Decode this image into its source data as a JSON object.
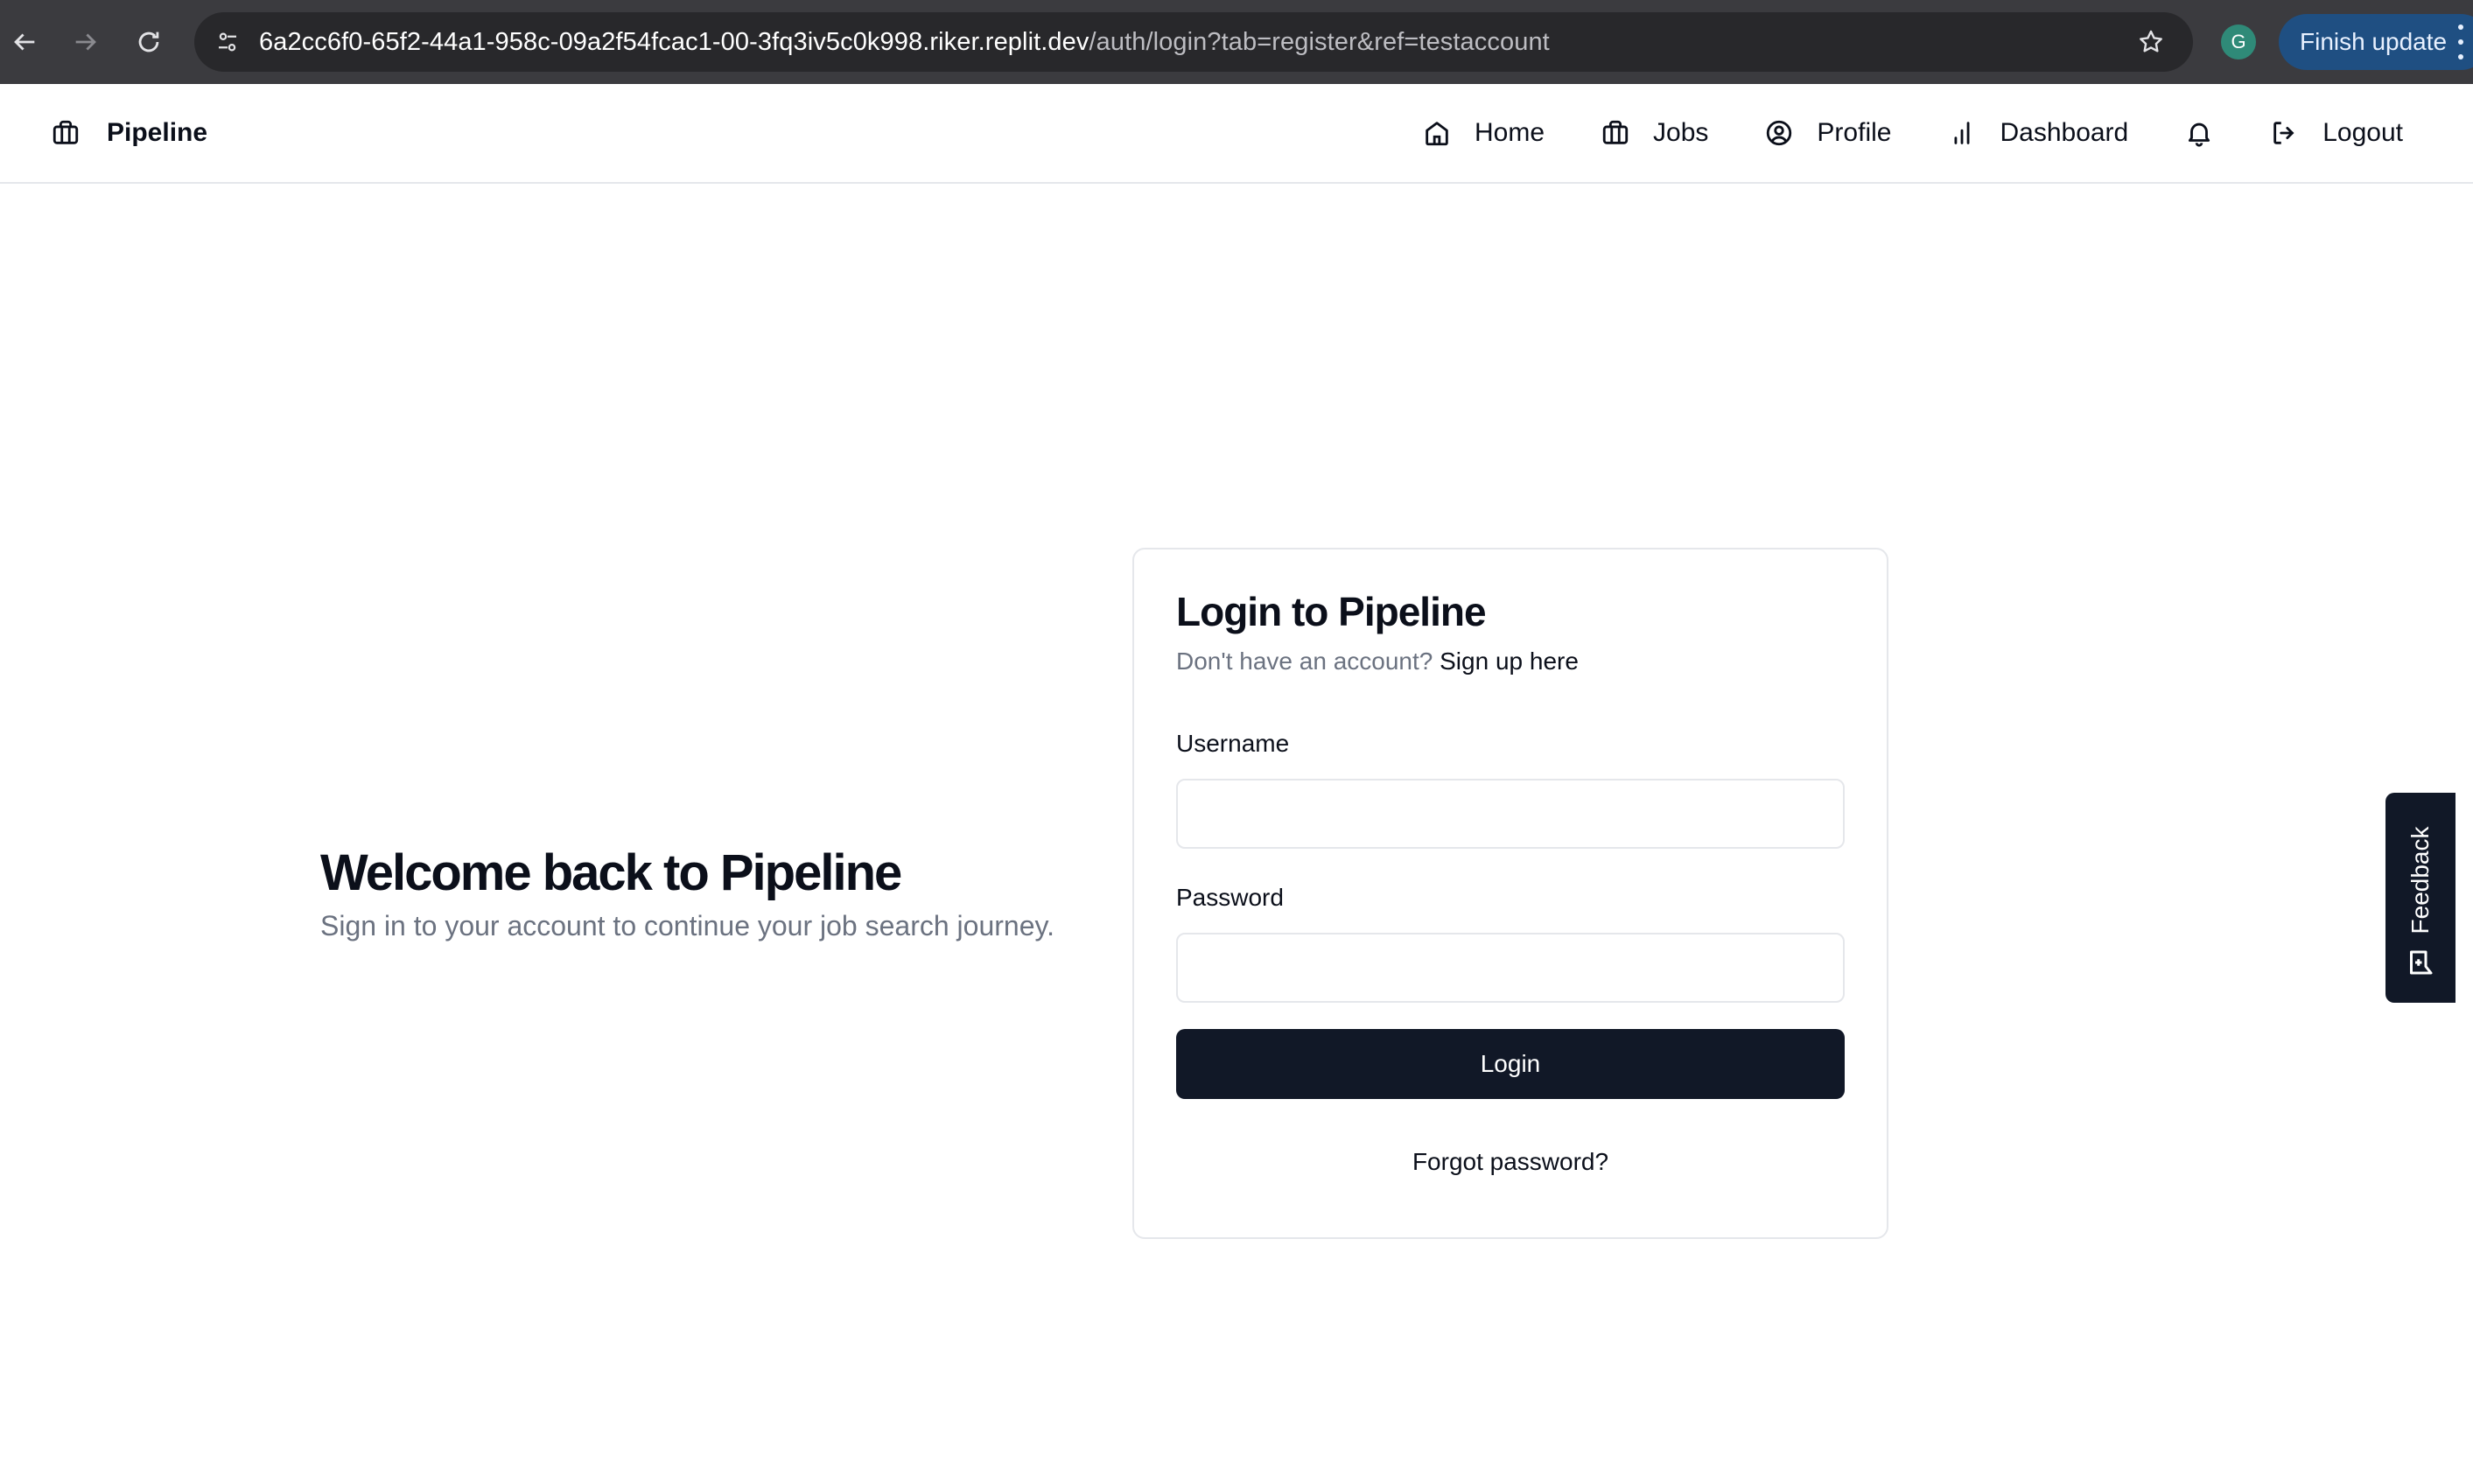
{
  "browser": {
    "url_host": "6a2cc6f0-65f2-44a1-958c-09a2f54fcac1-00-3fq3iv5c0k998.riker.replit.dev",
    "url_path": "/auth/login?tab=register&ref=testaccount",
    "avatar_letter": "G",
    "update_button_label": "Finish update"
  },
  "header": {
    "brand": "Pipeline",
    "nav": {
      "home": "Home",
      "jobs": "Jobs",
      "profile": "Profile",
      "dashboard": "Dashboard",
      "logout": "Logout"
    }
  },
  "welcome": {
    "title": "Welcome back to Pipeline",
    "subtitle": "Sign in to your account to continue your job search journey."
  },
  "login_card": {
    "title": "Login to Pipeline",
    "prompt": "Don't have an account?",
    "signup_link": "Sign up here",
    "username_label": "Username",
    "username_value": "",
    "password_label": "Password",
    "password_value": "",
    "login_button": "Login",
    "forgot_link": "Forgot password?"
  },
  "feedback": {
    "label": "Feedback"
  },
  "colors": {
    "primary": "#111827",
    "muted_text": "#6b7280",
    "border": "#e5e7eb",
    "chrome_bg": "#3b3b3f",
    "update_button": "#1f4f82"
  }
}
